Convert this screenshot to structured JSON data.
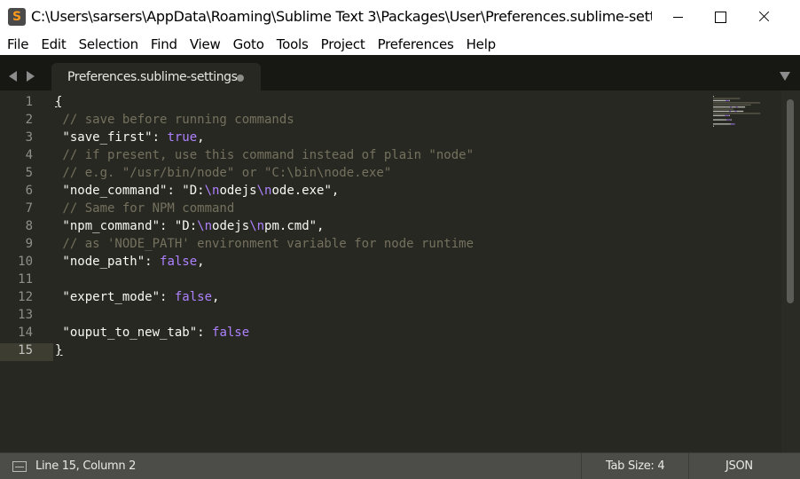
{
  "window": {
    "title": "C:\\Users\\sarsers\\AppData\\Roaming\\Sublime Text 3\\Packages\\User\\Preferences.sublime-setti..."
  },
  "menu": [
    "File",
    "Edit",
    "Selection",
    "Find",
    "View",
    "Goto",
    "Tools",
    "Project",
    "Preferences",
    "Help"
  ],
  "tab": {
    "label": "Preferences.sublime-settings"
  },
  "editor": {
    "active_line": 15,
    "lines": [
      {
        "num": "1",
        "tokens": [
          {
            "t": "{",
            "c": "brace"
          }
        ]
      },
      {
        "num": "2",
        "tokens": [
          {
            "t": " // save before running commands",
            "c": "cm"
          }
        ]
      },
      {
        "num": "3",
        "tokens": [
          {
            "t": " \"save_first\"",
            "c": "key"
          },
          {
            "t": ": ",
            "c": "key"
          },
          {
            "t": "true",
            "c": "bool"
          },
          {
            "t": ",",
            "c": "key"
          }
        ]
      },
      {
        "num": "4",
        "tokens": [
          {
            "t": " // if present, use this command instead of plain \"node\"",
            "c": "cm"
          }
        ]
      },
      {
        "num": "5",
        "tokens": [
          {
            "t": " // e.g. \"/usr/bin/node\" or \"C:\\bin\\node.exe\"",
            "c": "cm"
          }
        ]
      },
      {
        "num": "6",
        "tokens": [
          {
            "t": " \"node_command\"",
            "c": "key"
          },
          {
            "t": ": \"D:",
            "c": "key"
          },
          {
            "t": "\\n",
            "c": "esc"
          },
          {
            "t": "odejs",
            "c": "key"
          },
          {
            "t": "\\n",
            "c": "esc"
          },
          {
            "t": "ode.exe\",",
            "c": "key"
          }
        ]
      },
      {
        "num": "7",
        "tokens": [
          {
            "t": " // Same for NPM command",
            "c": "cm"
          }
        ]
      },
      {
        "num": "8",
        "tokens": [
          {
            "t": " \"npm_command\"",
            "c": "key"
          },
          {
            "t": ": \"D:",
            "c": "key"
          },
          {
            "t": "\\n",
            "c": "esc"
          },
          {
            "t": "odejs",
            "c": "key"
          },
          {
            "t": "\\n",
            "c": "esc"
          },
          {
            "t": "pm.cmd\",",
            "c": "key"
          }
        ]
      },
      {
        "num": "9",
        "tokens": [
          {
            "t": " // as 'NODE_PATH' environment variable for node runtime",
            "c": "cm"
          }
        ]
      },
      {
        "num": "10",
        "tokens": [
          {
            "t": " \"node_path\"",
            "c": "key"
          },
          {
            "t": ": ",
            "c": "key"
          },
          {
            "t": "false",
            "c": "bool"
          },
          {
            "t": ",",
            "c": "key"
          }
        ]
      },
      {
        "num": "11",
        "tokens": []
      },
      {
        "num": "12",
        "tokens": [
          {
            "t": " \"expert_mode\"",
            "c": "key"
          },
          {
            "t": ": ",
            "c": "key"
          },
          {
            "t": "false",
            "c": "bool"
          },
          {
            "t": ",",
            "c": "key"
          }
        ]
      },
      {
        "num": "13",
        "tokens": []
      },
      {
        "num": "14",
        "tokens": [
          {
            "t": " \"ouput_to_new_tab\"",
            "c": "key"
          },
          {
            "t": ": ",
            "c": "key"
          },
          {
            "t": "false",
            "c": "bool"
          }
        ]
      },
      {
        "num": "15",
        "tokens": [
          {
            "t": "}",
            "c": "brace"
          }
        ]
      }
    ]
  },
  "status": {
    "position": "Line 15, Column 2",
    "tab_size": "Tab Size: 4",
    "syntax": "JSON"
  },
  "colors": {
    "background": "#272822",
    "comment": "#75715e",
    "constant": "#ae81ff",
    "foreground": "#f8f8f2"
  }
}
